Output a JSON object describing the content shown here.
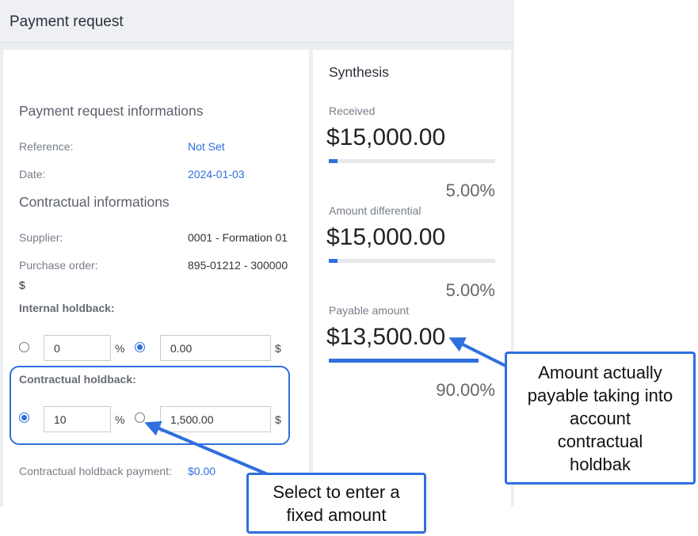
{
  "header": {
    "title": "Payment request"
  },
  "left": {
    "section1_title": "Payment request informations",
    "reference_label": "Reference:",
    "reference_value": "Not Set",
    "date_label": "Date:",
    "date_value": "2024-01-03",
    "section2_title": "Contractual informations",
    "supplier_label": "Supplier:",
    "supplier_value": "0001 - Formation 01",
    "po_label": "Purchase order:",
    "po_value": "895-01212 - 300000",
    "po_suffix": "$",
    "internal_holdback_label": "Internal holdback:",
    "internal_percent_value": "0",
    "internal_amount_value": "0.00",
    "contractual_holdback_label": "Contractual holdback:",
    "contractual_percent_value": "10",
    "contractual_amount_value": "1,500.00",
    "percent_sign": "%",
    "dollar_sign": "$",
    "holdback_payment_label": "Contractual holdback payment:",
    "holdback_payment_value": "$0.00"
  },
  "synthesis": {
    "title": "Synthesis",
    "received_label": "Received",
    "received_value": "$15,000.00",
    "received_pct": "5.00%",
    "received_fraction": 0.05,
    "differential_label": "Amount differential",
    "differential_value": "$15,000.00",
    "differential_pct": "5.00%",
    "differential_fraction": 0.05,
    "payable_label": "Payable amount",
    "payable_value": "$13,500.00",
    "payable_pct": "90.00%",
    "payable_fraction": 0.9
  },
  "callouts": {
    "fixed_amount": "Select to enter a\nfixed amount",
    "payable_note": "Amount actually\npayable taking into\naccount\ncontractual\nholdbak"
  },
  "colors": {
    "accent": "#2f6fde"
  }
}
